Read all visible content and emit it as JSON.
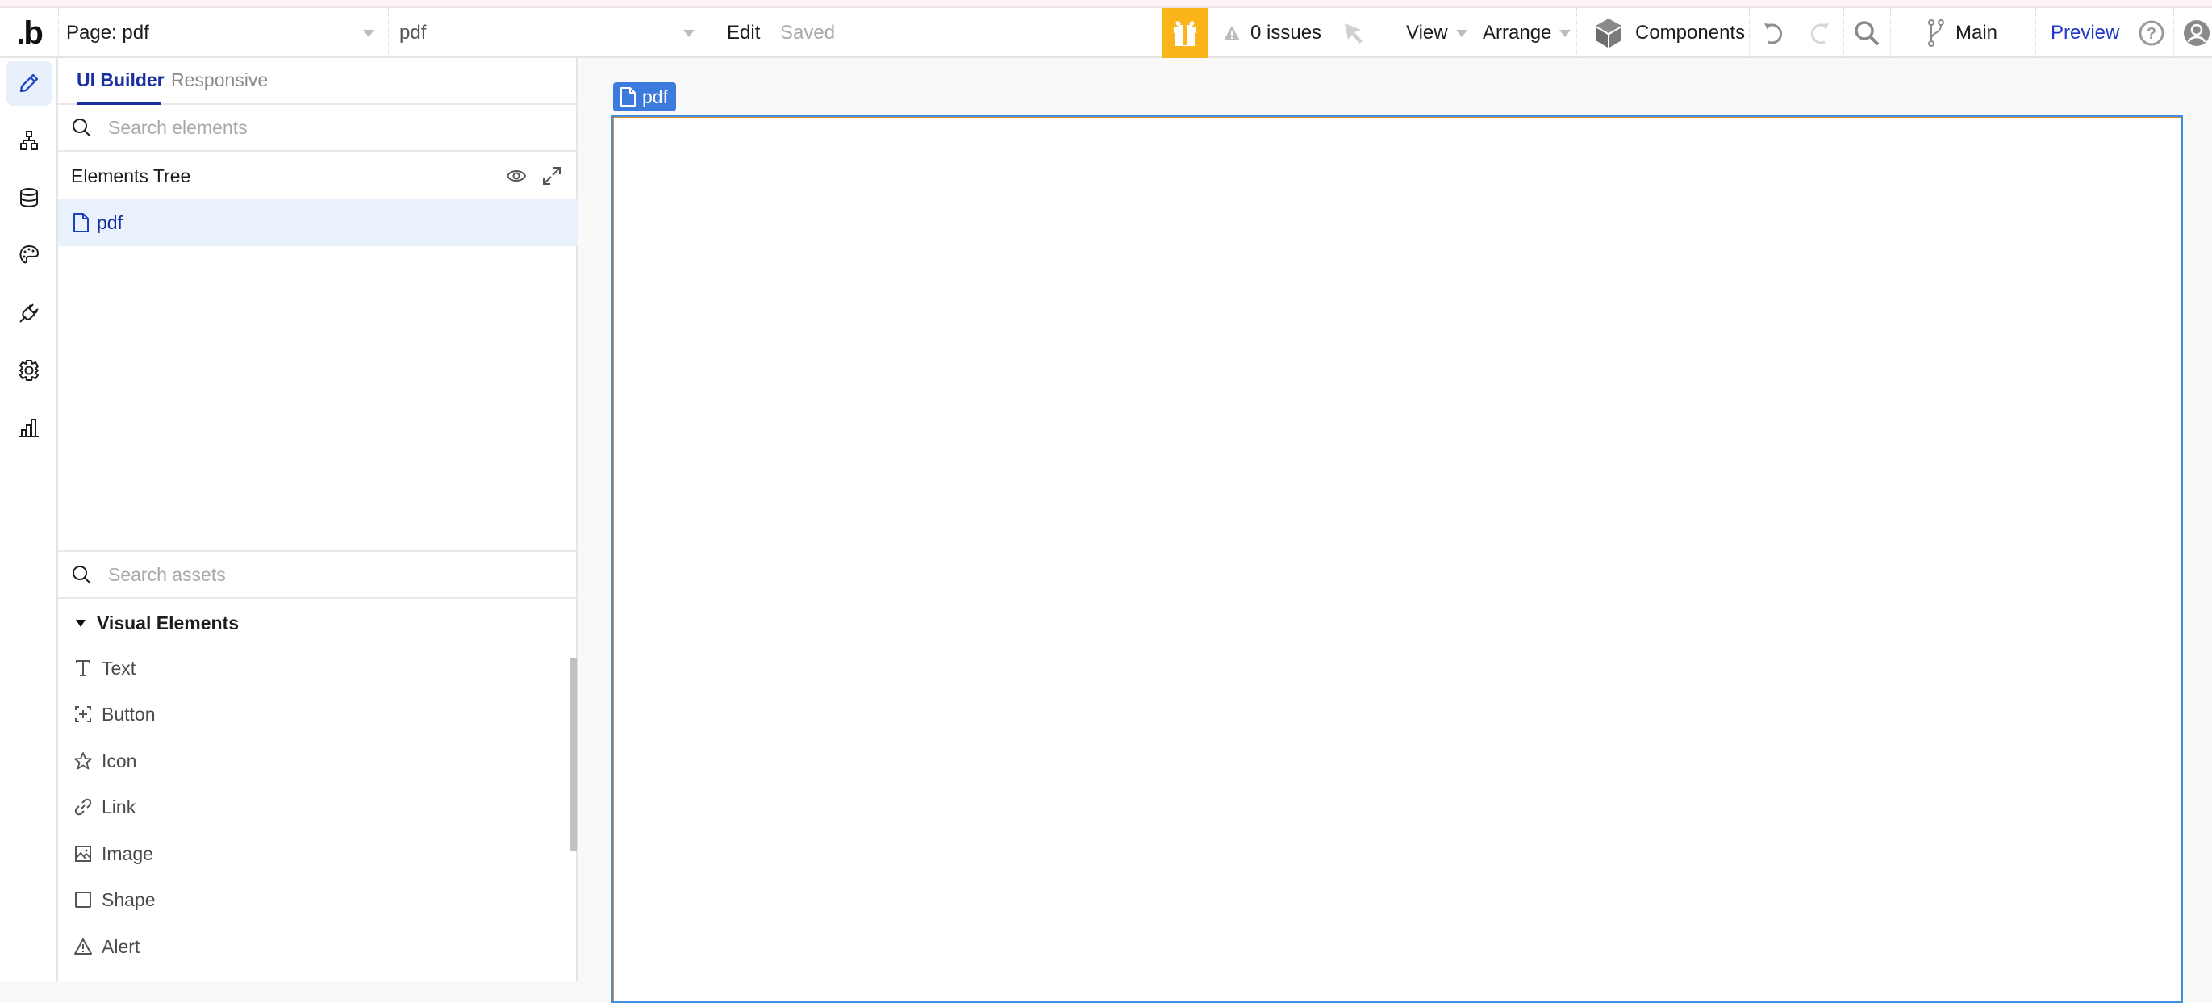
{
  "toolbar": {
    "logo": ".b",
    "page_selector": "Page: pdf",
    "element_selector": "pdf",
    "edit_label": "Edit",
    "save_status": "Saved",
    "issues": "0 issues",
    "view_label": "View",
    "arrange_label": "Arrange",
    "components_label": "Components",
    "branch_label": "Main",
    "preview_label": "Preview",
    "accent_gift": "#fbb51b",
    "preview_color": "#1f38c8"
  },
  "rail": {
    "items": [
      {
        "icon": "pencil-icon",
        "label": "Design",
        "active": true
      },
      {
        "icon": "workflow-icon",
        "label": "Workflow"
      },
      {
        "icon": "database-icon",
        "label": "Data"
      },
      {
        "icon": "palette-icon",
        "label": "Styles"
      },
      {
        "icon": "plugin-icon",
        "label": "Plugins"
      },
      {
        "icon": "gear-icon",
        "label": "Settings"
      },
      {
        "icon": "chart-icon",
        "label": "Logs"
      }
    ]
  },
  "panel": {
    "tabs": [
      {
        "label": "UI Builder",
        "active": true
      },
      {
        "label": "Responsive",
        "active": false
      }
    ],
    "search_elements_placeholder": "Search elements",
    "tree_title": "Elements Tree",
    "tree_items": [
      {
        "label": "pdf",
        "icon": "page-icon",
        "selected": true
      }
    ],
    "search_assets_placeholder": "Search assets",
    "asset_section": "Visual Elements",
    "asset_items": [
      {
        "label": "Text",
        "icon": "text-icon"
      },
      {
        "label": "Button",
        "icon": "button-icon"
      },
      {
        "label": "Icon",
        "icon": "star-icon"
      },
      {
        "label": "Link",
        "icon": "link-icon"
      },
      {
        "label": "Image",
        "icon": "image-icon"
      },
      {
        "label": "Shape",
        "icon": "shape-icon"
      },
      {
        "label": "Alert",
        "icon": "alert-icon"
      }
    ]
  },
  "canvas": {
    "page_label": "pdf",
    "label_color": "#3d7ade"
  }
}
